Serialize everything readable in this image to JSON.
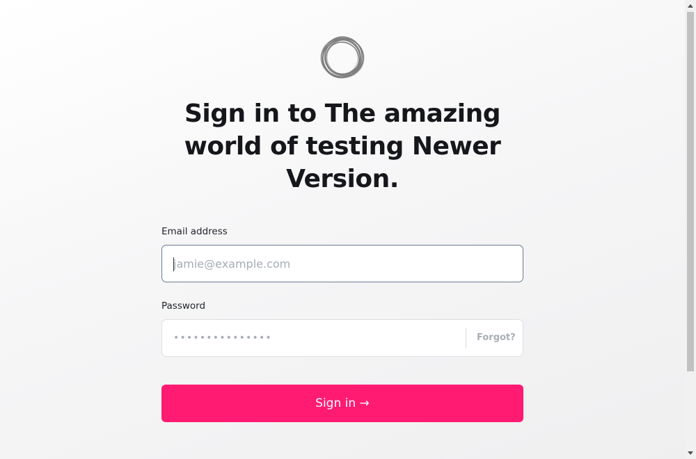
{
  "app": {
    "heading": "Sign in to The amazing world of testing Newer Version.",
    "logo_icon": "ring-logo-icon"
  },
  "form": {
    "email_label": "Email address",
    "email_placeholder": "jamie@example.com",
    "email_value": "",
    "password_label": "Password",
    "password_masked": "•••••••••••••••",
    "forgot_label": "Forgot?",
    "submit_label": "Sign in →"
  },
  "colors": {
    "accent": "#ff1b72",
    "heading": "#16171b",
    "placeholder": "#a6abb3"
  }
}
